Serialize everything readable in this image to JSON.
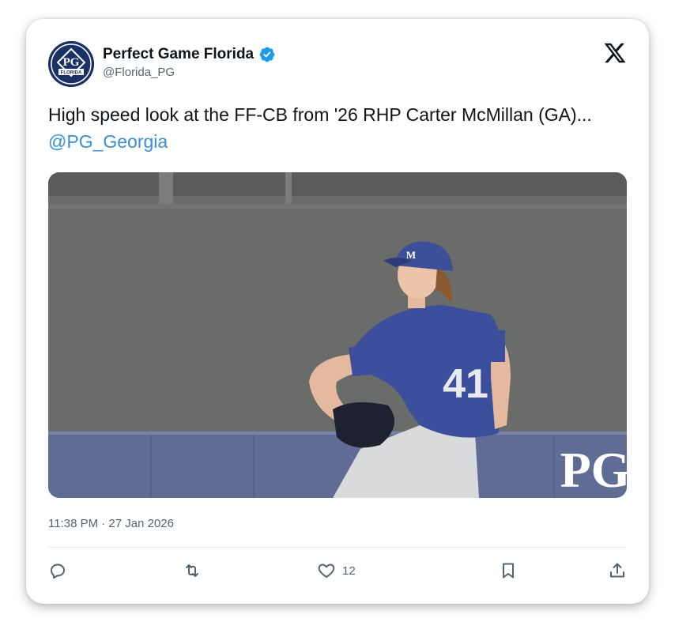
{
  "author": {
    "name": "Perfect Game Florida",
    "handle": "@Florida_PG",
    "avatar_text": "PG",
    "avatar_banner": "FLORIDA",
    "verified": true
  },
  "tweet": {
    "text_before": "High speed look at the FF-CB from '26 RHP Carter McMillan (GA)... ",
    "mention": "@PG_Georgia"
  },
  "media": {
    "type": "photo",
    "jersey_number": "41",
    "watermark": "PG"
  },
  "timestamp": "11:38 PM · 27 Jan 2026",
  "actions": {
    "like_count": "12"
  },
  "icons": [
    "x-logo-icon",
    "verified-badge-icon",
    "reply-icon",
    "retweet-icon",
    "heart-icon",
    "bookmark-icon",
    "share-icon"
  ],
  "colors": {
    "mention": "#3b8fd0",
    "verified": "#1d9bf0",
    "secondary_text": "#536471",
    "avatar_bg": "#1a3166"
  }
}
